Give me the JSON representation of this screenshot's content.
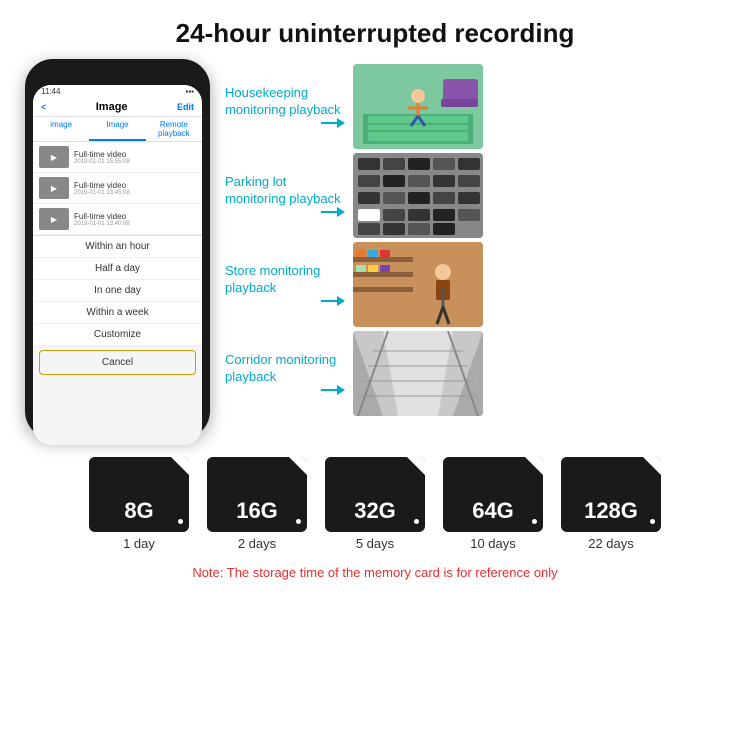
{
  "header": {
    "title": "24-hour uninterrupted recording"
  },
  "phone": {
    "time": "11:44",
    "nav_back": "<",
    "nav_title": "Image",
    "nav_edit": "Edit",
    "tabs": [
      "image",
      "Image",
      "Remote playback"
    ],
    "list_items": [
      {
        "label": "Full-time video",
        "date": "2019-01-01 15:55:08"
      },
      {
        "label": "Full-time video",
        "date": "2019-01-01 13:45:08"
      },
      {
        "label": "Full-time video",
        "date": "2019-01-01 13:40:08"
      }
    ],
    "dropdown": [
      "Within an hour",
      "Half a day",
      "In one day",
      "Within a week",
      "Customize"
    ],
    "cancel": "Cancel"
  },
  "monitoring": [
    {
      "id": "housekeeping",
      "label": "Housekeeping\nmonitoring playback"
    },
    {
      "id": "parking",
      "label": "Parking lot\nmonitoring playback"
    },
    {
      "id": "store",
      "label": "Store monitoring\nplayback"
    },
    {
      "id": "corridor",
      "label": "Corridor monitoring\nplayback"
    }
  ],
  "storage_cards": [
    {
      "size": "8G",
      "days": "1 day"
    },
    {
      "size": "16G",
      "days": "2 days"
    },
    {
      "size": "32G",
      "days": "5 days"
    },
    {
      "size": "64G",
      "days": "10 days"
    },
    {
      "size": "128G",
      "days": "22 days"
    }
  ],
  "note": "Note: The storage time of the memory card is for reference only"
}
